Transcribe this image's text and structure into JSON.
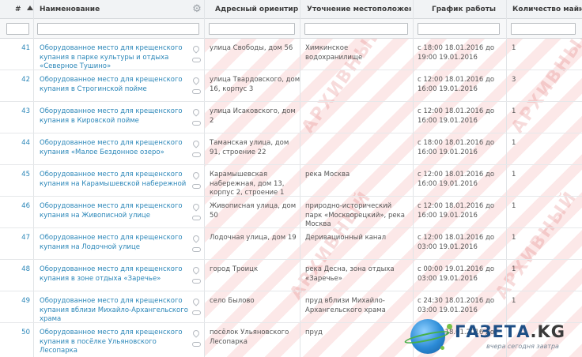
{
  "table": {
    "headers": {
      "num": "#",
      "name": "Наименование",
      "address": "Адресный ориентир",
      "spec": "Уточнение местоположен...",
      "schedule": "График работы",
      "qty": "Количество майн"
    },
    "rows": [
      {
        "num": "41",
        "name": "Оборудованное место для крещенского купания в парке культуры и отдыха «Северное Тушино»",
        "address": "улица Свободы, дом 56",
        "spec": "Химкинское водохранилище",
        "schedule": "с 18:00 18.01.2016 до 19:00 19.01.2016",
        "qty": "1"
      },
      {
        "num": "42",
        "name": "Оборудованное место для крещенского купания в Строгинской пойме",
        "address": "улица Твардовского, дом 16, корпус 3",
        "spec": "",
        "schedule": "с 12:00 18.01.2016 до 16:00 19.01.2016",
        "qty": "3"
      },
      {
        "num": "43",
        "name": "Оборудованное место для крещенского купания в Кировской пойме",
        "address": "улица Исаковского, дом 2",
        "spec": "",
        "schedule": "с 12:00 18.01.2016 до 16:00 19.01.2016",
        "qty": "1"
      },
      {
        "num": "44",
        "name": "Оборудованное место для крещенского купания «Малое Бездонное озеро»",
        "address": "Таманская улица, дом 91, строение 22",
        "spec": "",
        "schedule": "с 18:00 18.01.2016 до 16:00 19.01.2016",
        "qty": "1"
      },
      {
        "num": "45",
        "name": "Оборудованное место для крещенского купания на Карамышевской набережной",
        "address": "Карамышевская набережная, дом 13, корпус 2, строение 1",
        "spec": "река Москва",
        "schedule": "с 12:00 18.01.2016 до 16:00 19.01.2016",
        "qty": "1"
      },
      {
        "num": "46",
        "name": "Оборудованное место для крещенского купания на Живописной улице",
        "address": "Живописная улица, дом 50",
        "spec": "природно-исторический парк «Москворецкий», река Москва",
        "schedule": "с 12:00 18.01.2016 до 16:00 19.01.2016",
        "qty": "1"
      },
      {
        "num": "47",
        "name": "Оборудованное место для крещенского купания на Лодочной улице",
        "address": "Лодочная улица, дом 19",
        "spec": "Деривационный канал",
        "schedule": "с 12:00 18.01.2016 до 03:00 19.01.2016",
        "qty": "1"
      },
      {
        "num": "48",
        "name": "Оборудованное место для крещенского купания в зоне отдыха «Заречье»",
        "address": "город Троицк",
        "spec": "река Десна, зона отдыха «Заречье»",
        "schedule": "с 00:00 19.01.2016 до 03:00 19.01.2016",
        "qty": "1"
      },
      {
        "num": "49",
        "name": "Оборудованное место для крещенского купания вблизи Михайло-Архангельского храма",
        "address": "село Былово",
        "spec": "пруд вблизи Михайло-Архангельского храма",
        "schedule": "с 24:30 18.01.2016 до 03:00 19.01.2016",
        "qty": "1"
      },
      {
        "num": "50",
        "name": "Оборудованное место для крещенского купания в посёлке Ульяновского Лесопарка",
        "address": "посёлок Ульяновского Лесопарка",
        "spec": "пруд",
        "schedule": "с 12:00 18.01.2016 до",
        "qty": ""
      }
    ]
  },
  "watermark": {
    "text": "АРХИВНЫЙ"
  },
  "logo": {
    "brand": "ГАЗЕТА",
    "tld": ".KG",
    "tagline": "вчера сегодня завтра"
  },
  "colors": {
    "link": "#2a86b8",
    "header_bg": "#f1f3f5",
    "watermark": "#f09696"
  }
}
